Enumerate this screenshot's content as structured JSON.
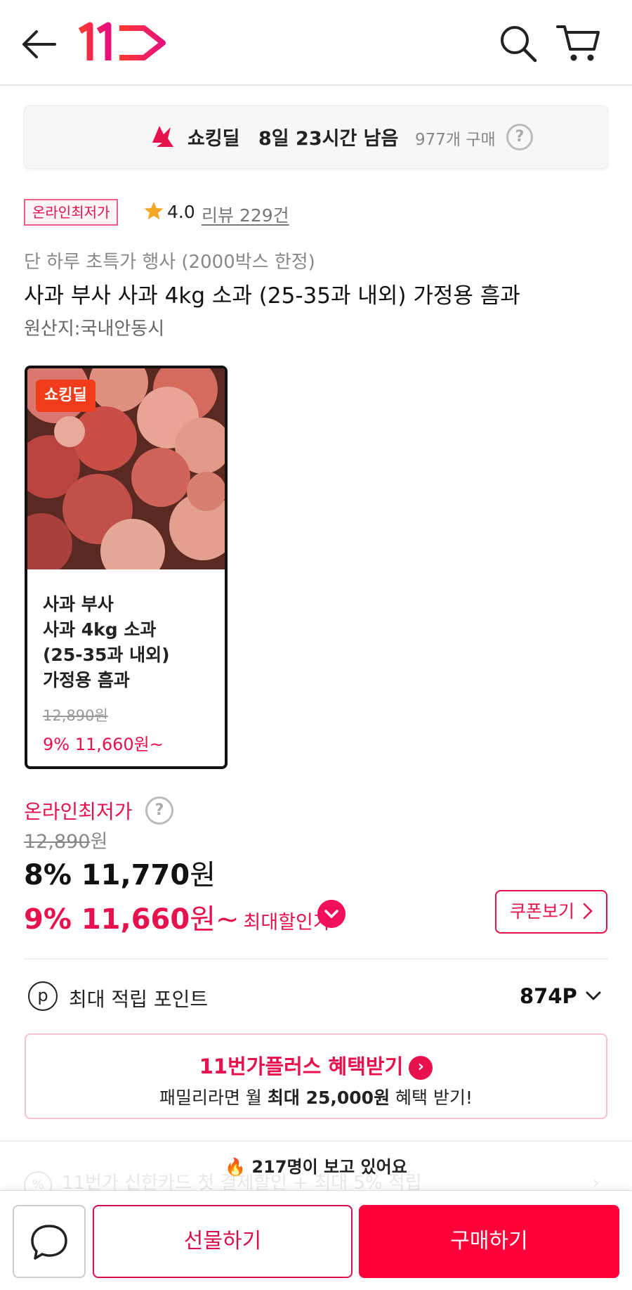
{
  "header": {
    "back_icon": "arrow-left-icon",
    "logo_icon": "11st-logo",
    "search_icon": "search-icon",
    "cart_icon": "cart-icon"
  },
  "deal_banner": {
    "label": "쇼킹딜",
    "time_left": "8일 23시간 남음",
    "purchase_count": "977개 구매",
    "help": "?"
  },
  "tags": {
    "lowest_price_badge": "온라인최저가",
    "rating": "4.0",
    "reviews": "리뷰 229건"
  },
  "product": {
    "promo": "단 하루 초특가 행사 (2000박스 한정)",
    "title": "사과 부사 사과 4kg 소과 (25-35과 내외) 가정용 흠과",
    "origin": "원산지:국내안동시"
  },
  "option_card": {
    "badge": "쇼킹딜",
    "name": "사과 부사\n사과 4kg 소과\n(25-35과 내외)\n가정용 흠과",
    "original_price": "12,890원",
    "sale_price": "9% 11,660원~"
  },
  "pricing": {
    "label": "온라인최저가",
    "help": "?",
    "original_price": "12,890",
    "original_unit": "원",
    "discount_price": "8% 11,770",
    "discount_unit": "원",
    "max_price": "9% 11,660",
    "max_unit": "원~",
    "max_label": "최대할인가",
    "coupon_button": "쿠폰보기"
  },
  "points": {
    "icon_text": "p",
    "label": "최대 적립 포인트",
    "value": "874P"
  },
  "plus_banner": {
    "title": "11번가플러스 혜택받기",
    "subtitle_prefix": "패밀리라면 월 ",
    "subtitle_bold": "최대 25,000원",
    "subtitle_suffix": " 혜택 받기!"
  },
  "viewers": {
    "text": "🔥 217명이 보고 있어요"
  },
  "card_benefit": {
    "text": "11번가 신한카드 첫 결제할인 + 최대 5% 적립"
  },
  "bottom_bar": {
    "chat_icon": "chat-bubble-icon",
    "gift_button": "선물하기",
    "buy_button": "구매하기"
  },
  "colors": {
    "brand": "#e6114d",
    "buy": "#ff0038",
    "deal_badge": "#f03c1b",
    "star": "#f5a623"
  }
}
